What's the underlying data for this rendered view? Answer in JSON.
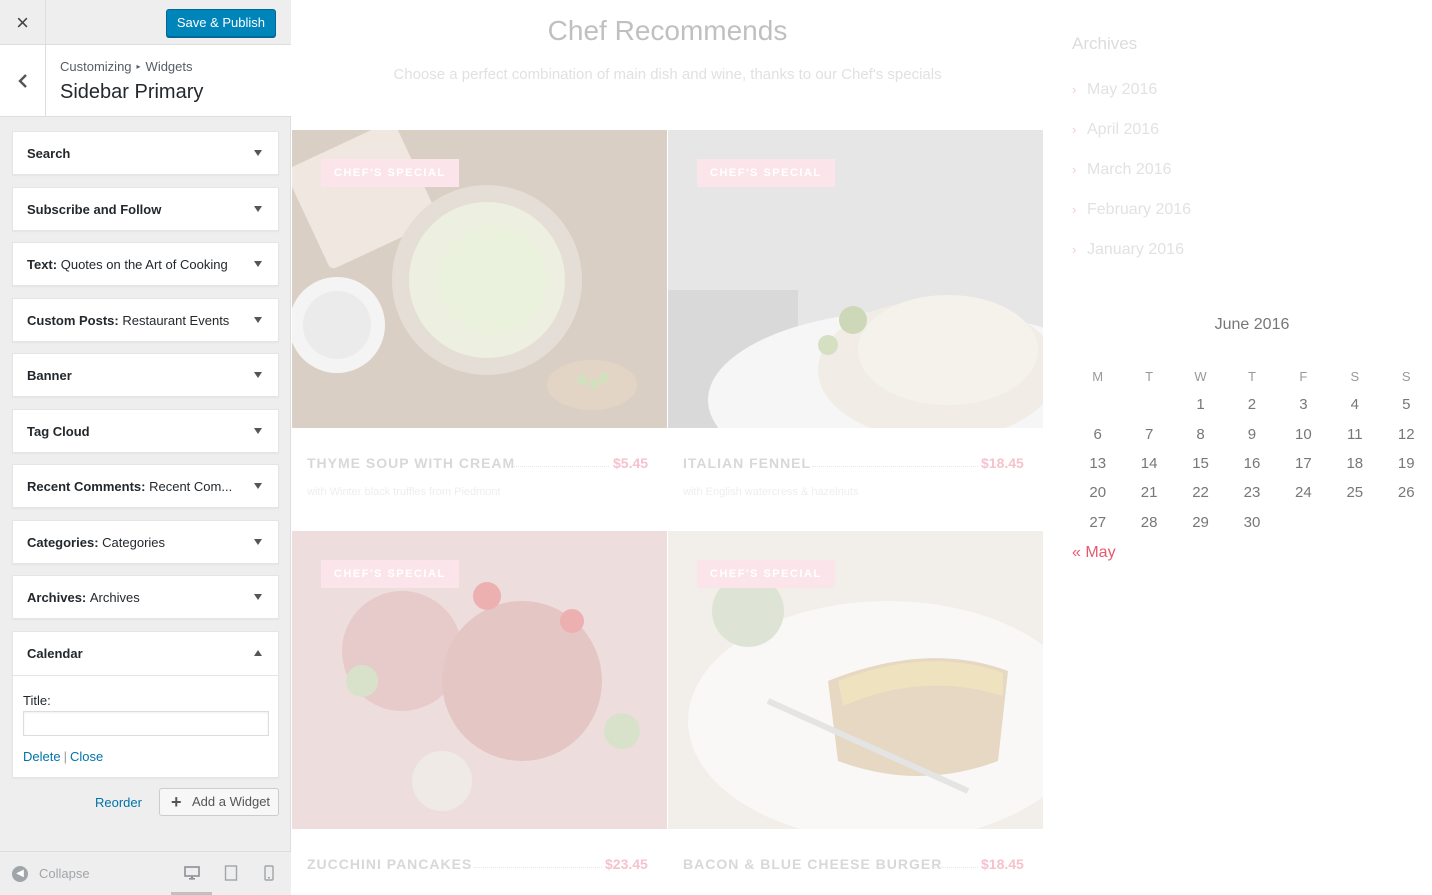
{
  "customizer": {
    "close_label": "×",
    "save_label": "Save & Publish",
    "breadcrumb": [
      "Customizing",
      "Widgets"
    ],
    "breadcrumb_sep": "▸",
    "panel_title": "Sidebar Primary",
    "widgets": [
      {
        "type": "Search",
        "title": ""
      },
      {
        "type": "Subscribe and Follow",
        "title": ""
      },
      {
        "type": "Text:",
        "title": "Quotes on the Art of Cooking"
      },
      {
        "type": "Custom Posts:",
        "title": "Restaurant Events"
      },
      {
        "type": "Banner",
        "title": ""
      },
      {
        "type": "Tag Cloud",
        "title": ""
      },
      {
        "type": "Recent Comments:",
        "title": "Recent Com..."
      },
      {
        "type": "Categories:",
        "title": "Categories"
      },
      {
        "type": "Archives:",
        "title": "Archives"
      }
    ],
    "calendar_widget": {
      "type": "Calendar",
      "title_label": "Title:",
      "title_value": "",
      "delete_label": "Delete",
      "close_label": "Close",
      "separator": "|"
    },
    "reorder_label": "Reorder",
    "add_widget_label": "Add a Widget",
    "add_widget_icon": "+",
    "collapse_label": "Collapse",
    "collapse_icon": "◀",
    "devices": [
      "desktop-icon",
      "tablet-icon",
      "mobile-icon"
    ]
  },
  "preview": {
    "section_title": "Chef Recommends",
    "section_subtitle": "Choose a perfect combination of main dish and wine, thanks to our Chef's specials",
    "dishes": [
      {
        "badge": "CHEF'S SPECIAL",
        "name": "THYME SOUP WITH CREAM",
        "price": "$5.45",
        "desc": "with Winter black truffles from Piedmont"
      },
      {
        "badge": "CHEF'S SPECIAL",
        "name": "ITALIAN FENNEL",
        "price": "$18.45",
        "desc": "with English watercress & hazelnuts"
      },
      {
        "badge": "CHEF'S SPECIAL",
        "name": "ZUCCHINI PANCAKES",
        "price": "$23.45",
        "desc": ""
      },
      {
        "badge": "CHEF'S SPECIAL",
        "name": "BACON & BLUE CHEESE BURGER",
        "price": "$18.45",
        "desc": ""
      }
    ],
    "archives": {
      "title": "Archives",
      "months": [
        "May 2016",
        "April 2016",
        "March 2016",
        "February 2016",
        "January 2016"
      ],
      "chevron": "›"
    },
    "calendar": {
      "caption": "June 2016",
      "weekdays": [
        "M",
        "T",
        "W",
        "T",
        "F",
        "S",
        "S"
      ],
      "rows": [
        [
          "",
          "",
          "1",
          "2",
          "3",
          "4",
          "5"
        ],
        [
          "6",
          "7",
          "8",
          "9",
          "10",
          "11",
          "12"
        ],
        [
          "13",
          "14",
          "15",
          "16",
          "17",
          "18",
          "19"
        ],
        [
          "20",
          "21",
          "22",
          "23",
          "24",
          "25",
          "26"
        ],
        [
          "27",
          "28",
          "29",
          "30",
          "",
          "",
          ""
        ]
      ],
      "prev_link": "« May"
    }
  },
  "colors": {
    "primary_button": "#0085ba",
    "link": "#0073aa",
    "accent_pink": "#e55a6f"
  }
}
